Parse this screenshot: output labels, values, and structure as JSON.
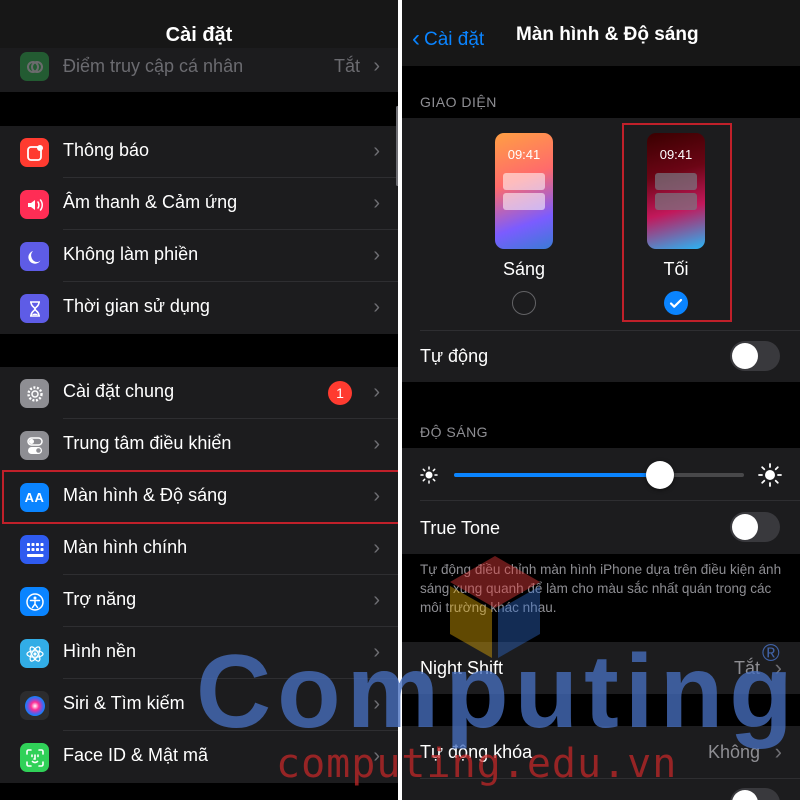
{
  "left": {
    "title": "Cài đặt",
    "hotspot": {
      "label": "Điểm truy cập cá nhân",
      "value": "Tắt"
    },
    "group1": [
      {
        "label": "Thông báo",
        "icon": "notifications-icon",
        "color": "#ff3b30"
      },
      {
        "label": "Âm thanh & Cảm ứng",
        "icon": "sound-icon",
        "color": "#ff2d55"
      },
      {
        "label": "Không làm phiền",
        "icon": "moon-icon",
        "color": "#5e5ce6"
      },
      {
        "label": "Thời gian sử dụng",
        "icon": "hourglass-icon",
        "color": "#5e5ce6"
      }
    ],
    "group2": [
      {
        "label": "Cài đặt chung",
        "icon": "gear-icon",
        "color": "#8e8e93",
        "badge": "1"
      },
      {
        "label": "Trung tâm điều khiển",
        "icon": "toggles-icon",
        "color": "#8e8e93"
      },
      {
        "label": "Màn hình & Độ sáng",
        "icon": "display-icon",
        "color": "#0a84ff",
        "icon_text": "AA"
      },
      {
        "label": "Màn hình chính",
        "icon": "home-screen-icon",
        "color": "#2f5bf0"
      },
      {
        "label": "Trợ năng",
        "icon": "accessibility-icon",
        "color": "#0a84ff"
      },
      {
        "label": "Hình nền",
        "icon": "wallpaper-icon",
        "color": "#32ade6"
      },
      {
        "label": "Siri & Tìm kiếm",
        "icon": "siri-icon",
        "color": "#2c2c2e"
      },
      {
        "label": "Face ID & Mật mã",
        "icon": "faceid-icon",
        "color": "#30d158"
      }
    ]
  },
  "right": {
    "back_label": "Cài đặt",
    "title": "Màn hình & Độ sáng",
    "appearance_header": "GIAO DIỆN",
    "light": {
      "label": "Sáng",
      "time": "09:41"
    },
    "dark": {
      "label": "Tối",
      "time": "09:41"
    },
    "auto_label": "Tự động",
    "brightness_header": "ĐỘ SÁNG",
    "brightness_level": 0.71,
    "true_tone_label": "True Tone",
    "true_tone_note": "Tự động điều chỉnh màn hình iPhone dựa trên điều kiện ánh sáng xung quanh để làm cho màu sắc nhất quán trong các môi trường khác nhau.",
    "night_shift": {
      "label": "Night Shift",
      "value": "Tắt"
    },
    "auto_lock": {
      "label": "Tự động khóa",
      "value": "Không"
    }
  },
  "watermark": {
    "name": "Computing",
    "url": "computing.edu.vn",
    "mark": "®"
  },
  "colors": {
    "accent": "#0a84ff",
    "highlight": "#c0202a",
    "background": "#000000",
    "cell": "#1c1c1e"
  }
}
